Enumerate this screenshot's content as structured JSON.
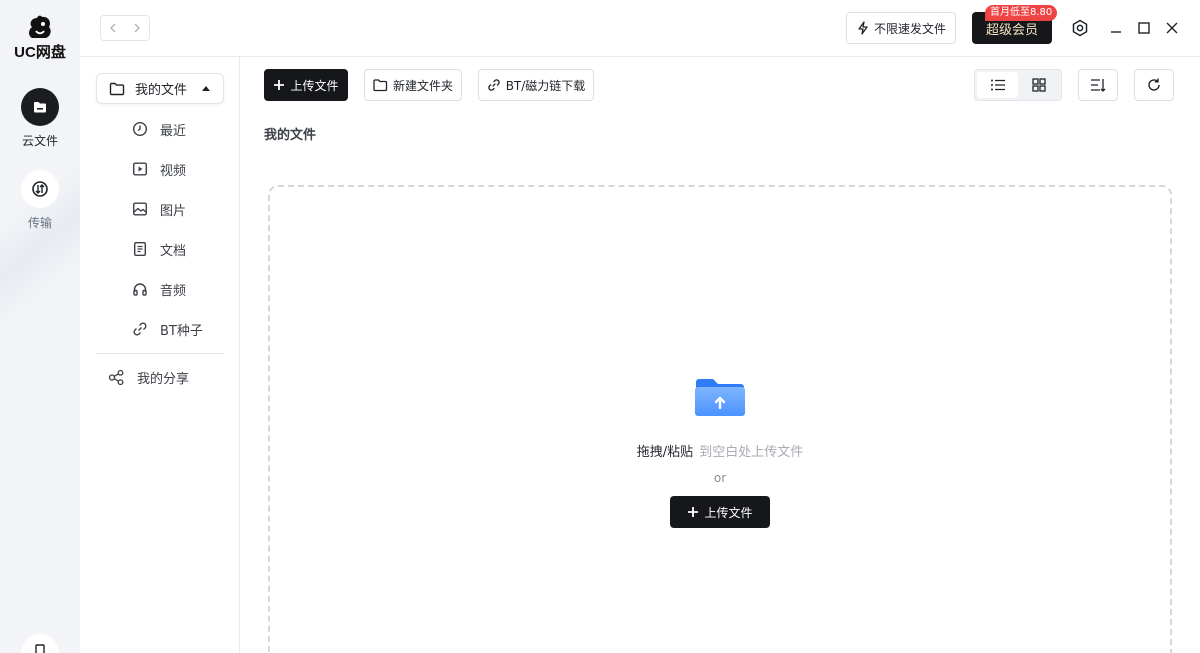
{
  "app": {
    "logo_text": "UC网盘"
  },
  "rail": {
    "items": [
      {
        "label": "云文件",
        "icon": "cloud-file-icon",
        "active": true
      },
      {
        "label": "传输",
        "icon": "transfer-icon",
        "active": false
      }
    ]
  },
  "header": {
    "speed_label": "不限速发文件",
    "vip_label": "超级会员",
    "vip_badge": "首月低至8.80"
  },
  "sidebar": {
    "root_label": "我的文件",
    "items": [
      {
        "label": "最近",
        "icon": "clock-icon"
      },
      {
        "label": "视频",
        "icon": "video-icon"
      },
      {
        "label": "图片",
        "icon": "image-icon"
      },
      {
        "label": "文档",
        "icon": "document-icon"
      },
      {
        "label": "音频",
        "icon": "headphones-icon"
      },
      {
        "label": "BT种子",
        "icon": "link-icon"
      }
    ],
    "share_label": "我的分享"
  },
  "toolbar": {
    "upload_label": "上传文件",
    "new_folder_label": "新建文件夹",
    "bt_label": "BT/磁力链下载"
  },
  "main": {
    "title": "我的文件",
    "drop_hint_primary": "拖拽/粘贴",
    "drop_hint_secondary": "到空白处上传文件",
    "or_text": "or",
    "upload_label": "上传文件"
  },
  "colors": {
    "primary_dark": "#15171b",
    "vip_badge": "#ef4444",
    "folder_blue": "#3d8bff"
  }
}
